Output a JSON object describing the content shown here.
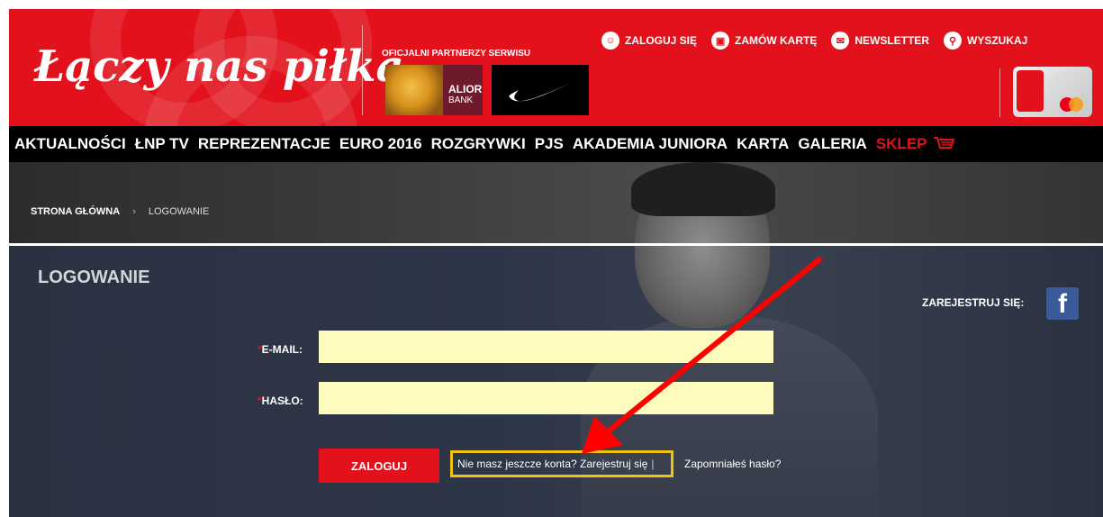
{
  "header": {
    "logo_text": "Łączy nas piłka",
    "partners_label": "OFICJALNI PARTNERZY SERWISU",
    "alior_line1": "ALIOR",
    "alior_line2": "BANK",
    "top_links": [
      {
        "label": "ZALOGUJ SIĘ",
        "icon": "user-icon"
      },
      {
        "label": "ZAMÓW KARTĘ",
        "icon": "card-icon"
      },
      {
        "label": "NEWSLETTER",
        "icon": "mail-icon"
      },
      {
        "label": "WYSZUKAJ",
        "icon": "search-icon"
      }
    ]
  },
  "nav": {
    "items": [
      "AKTUALNOŚCI",
      "ŁNP TV",
      "REPREZENTACJE",
      "EURO 2016",
      "ROZGRYWKI",
      "PJS",
      "AKADEMIA JUNIORA",
      "KARTA",
      "GALERIA"
    ],
    "shop_label": "SKLEP"
  },
  "breadcrumb": {
    "home": "STRONA GŁÓWNA",
    "separator": "›",
    "current": "LOGOWANIE"
  },
  "login": {
    "title": "LOGOWANIE",
    "fb_label": "ZAREJESTRUJ SIĘ:",
    "email_label": "E-MAIL:",
    "password_label": "HASŁO:",
    "required_mark": "*",
    "submit_label": "ZALOGUJ",
    "no_account_text": "Nie masz jeszcze konta? Zarejestruj się",
    "link_divider": "|",
    "forgot_text": "Zapomniałeś hasło?"
  },
  "colors": {
    "brand_red": "#e3111b",
    "input_yellow": "#fdfbbd",
    "highlight_yellow": "#f2c30c",
    "facebook_blue": "#3b5a9a"
  }
}
